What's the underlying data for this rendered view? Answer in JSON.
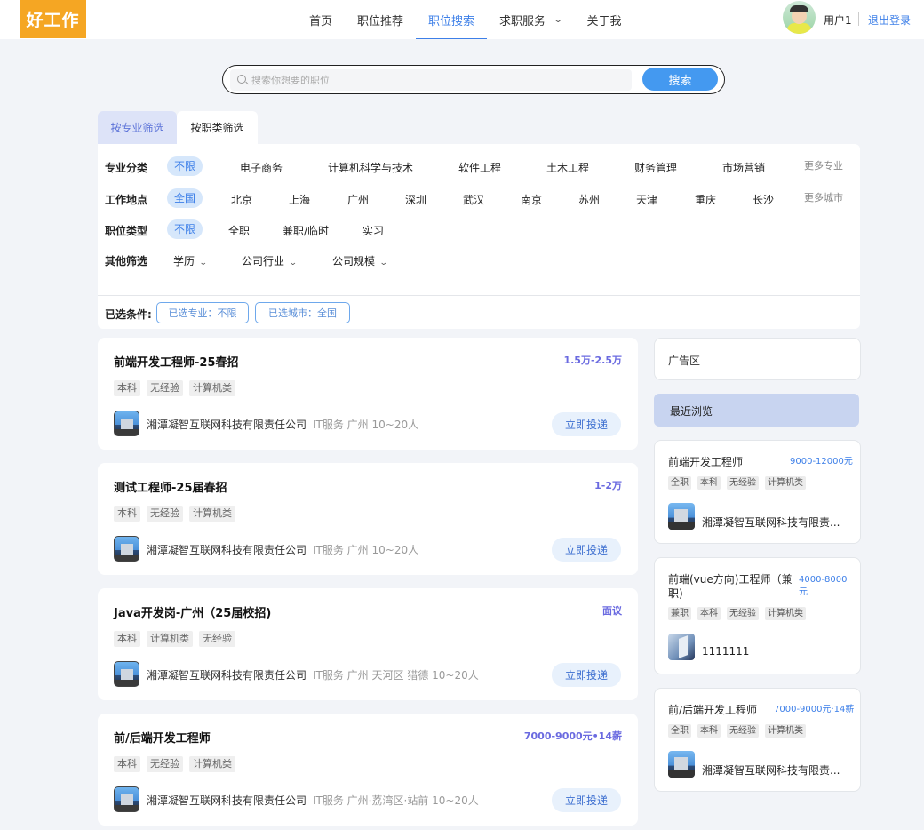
{
  "header": {
    "logo": "好工作",
    "nav": [
      {
        "label": "首页",
        "active": false
      },
      {
        "label": "职位推荐",
        "active": false
      },
      {
        "label": "职位搜索",
        "active": true
      },
      {
        "label": "求职服务",
        "active": false,
        "dropdown": true
      },
      {
        "label": "关于我",
        "active": false
      }
    ],
    "username": "用户1",
    "logout": "退出登录"
  },
  "search": {
    "placeholder": "搜索你想要的职位",
    "value": "",
    "button": "搜索"
  },
  "filter_tabs": [
    "按专业筛选",
    "按职类筛选"
  ],
  "filters": {
    "major": {
      "label": "专业分类",
      "options": [
        "不限",
        "电子商务",
        "计算机科学与技术",
        "软件工程",
        "土木工程",
        "财务管理",
        "市场营销"
      ],
      "selected": "不限",
      "more": "更多专业"
    },
    "city": {
      "label": "工作地点",
      "options": [
        "全国",
        "北京",
        "上海",
        "广州",
        "深圳",
        "武汉",
        "南京",
        "苏州",
        "天津",
        "重庆",
        "长沙"
      ],
      "selected": "全国",
      "more": "更多城市"
    },
    "type": {
      "label": "职位类型",
      "options": [
        "不限",
        "全职",
        "兼职/临时",
        "实习"
      ],
      "selected": "不限"
    },
    "other": {
      "label": "其他筛选",
      "dropdowns": [
        "学历",
        "公司行业",
        "公司规模"
      ]
    },
    "selected_label": "已选条件:",
    "chips": [
      "已选专业：不限",
      "已选城市：全国"
    ]
  },
  "jobs": [
    {
      "title": "前端开发工程师-25春招",
      "salary": "1.5万-2.5万",
      "tags": [
        "本科",
        "无经验",
        "计算机类"
      ],
      "company": "湘潭凝智互联网科技有限责任公司",
      "info": "IT服务  广州  10~20人",
      "apply": "立即投递"
    },
    {
      "title": "测试工程师-25届春招",
      "salary": "1-2万",
      "tags": [
        "本科",
        "无经验",
        "计算机类"
      ],
      "company": "湘潭凝智互联网科技有限责任公司",
      "info": "IT服务  广州  10~20人",
      "apply": "立即投递"
    },
    {
      "title": "Java开发岗-广州（25届校招)",
      "salary": "面议",
      "tags": [
        "本科",
        "计算机类",
        "无经验"
      ],
      "company": "湘潭凝智互联网科技有限责任公司",
      "info": "IT服务  广州 天河区 猎德  10~20人",
      "apply": "立即投递"
    },
    {
      "title": "前/后端开发工程师",
      "salary": "7000-9000元•14薪",
      "tags": [
        "本科",
        "无经验",
        "计算机类"
      ],
      "company": "湘潭凝智互联网科技有限责任公司",
      "info": "IT服务  广州·荔湾区·站前  10~20人",
      "apply": "立即投递"
    }
  ],
  "sidebar": {
    "ad": "广告区",
    "recent_title": "最近浏览",
    "recent": [
      {
        "title": "前端开发工程师",
        "salary": "9000-12000元",
        "tags": [
          "全职",
          "本科",
          "无经验",
          "计算机类"
        ],
        "company": "湘潭凝智互联网科技有限责..."
      },
      {
        "title": "前端(vue方向)工程师（兼职)",
        "salary": "4000-8000元",
        "tags": [
          "兼职",
          "本科",
          "无经验",
          "计算机类"
        ],
        "company": "1111111"
      },
      {
        "title": "前/后端开发工程师",
        "salary": "7000-9000元·14薪",
        "tags": [
          "全职",
          "本科",
          "无经验",
          "计算机类"
        ],
        "company": "湘潭凝智互联网科技有限责..."
      }
    ]
  }
}
